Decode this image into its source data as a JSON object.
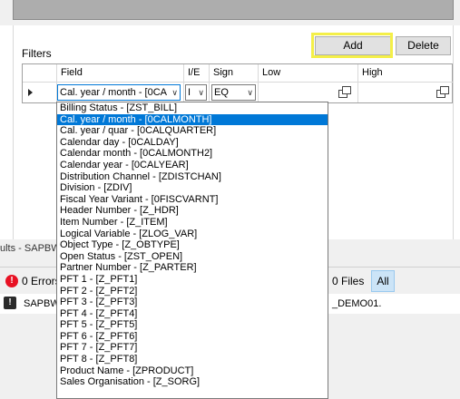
{
  "filters": {
    "label": "Filters",
    "buttons": {
      "add": "Add",
      "delete": "Delete"
    },
    "columns": {
      "field": "Field",
      "ie": "I/E",
      "sign": "Sign",
      "low": "Low",
      "high": "High"
    },
    "row": {
      "field_value": "Cal. year / month - [0CA",
      "ie_value": "I",
      "sign_value": "EQ"
    }
  },
  "dropdown": {
    "items": [
      "Billing Status - [ZST_BILL]",
      "Cal. year / month - [0CALMONTH]",
      "Cal. year / quar - [0CALQUARTER]",
      "Calendar day - [0CALDAY]",
      "Calendar month - [0CALMONTH2]",
      "Calendar year - [0CALYEAR]",
      "Distribution Channel - [ZDISTCHAN]",
      "Division - [ZDIV]",
      "Fiscal Year Variant - [0FISCVARNT]",
      "Header Number - [Z_HDR]",
      "Item Number - [Z_ITEM]",
      "Logical Variable - [ZLOG_VAR]",
      "Object Type - [Z_OBTYPE]",
      "Open Status - [ZST_OPEN]",
      "Partner Number - [Z_PARTER]",
      "PFT 1 - [Z_PFT1]",
      "PFT 2 - [Z_PFT2]",
      "PFT 3 - [Z_PFT3]",
      "PFT 4 - [Z_PFT4]",
      "PFT 5 - [Z_PFT5]",
      "PFT 6 - [Z_PFT6]",
      "PFT 7 - [Z_PFT7]",
      "PFT 8 - [Z_PFT8]",
      "Product Name - [ZPRODUCT]",
      "Sales Organisation - [Z_SORG]"
    ],
    "selected_index": 1
  },
  "results": {
    "title": "ults - SAPBW",
    "errors_label": "0 Errors",
    "files_label": "0 Files",
    "all_label": "All",
    "message_left": "SAPBW",
    "message_right": "_DEMO01."
  },
  "colors": {
    "selection": "#0078d7",
    "highlight": "#f4ef48",
    "error": "#e81123"
  }
}
